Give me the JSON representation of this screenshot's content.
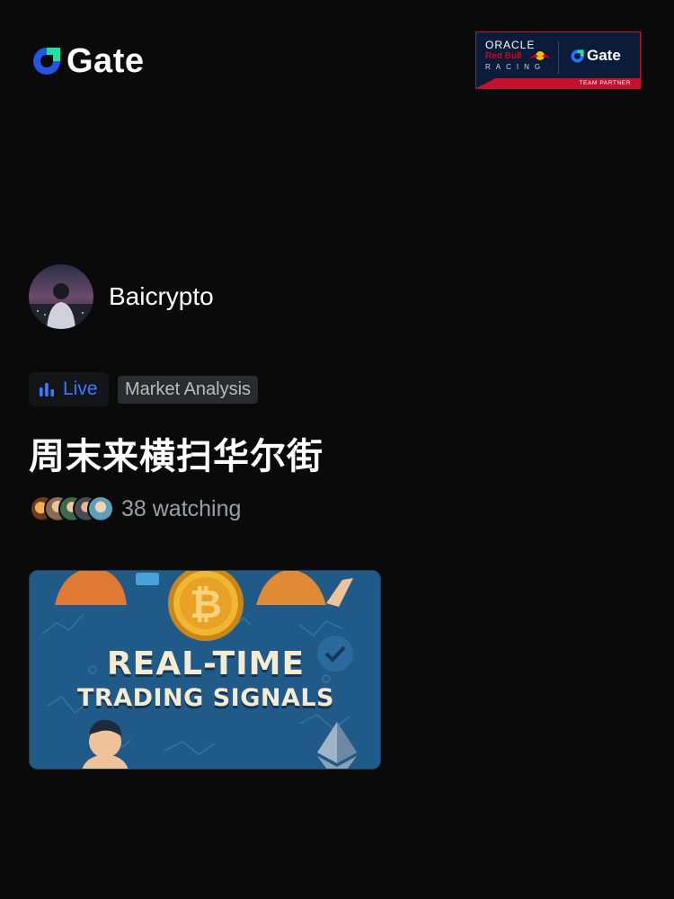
{
  "header": {
    "brand": "Gate",
    "sponsor": {
      "line1": "ORACLE",
      "line2": "Red Bull",
      "line3": "RACING",
      "partner_brand": "Gate",
      "badge": "TEAM PARTNER"
    }
  },
  "profile": {
    "username": "Baicrypto"
  },
  "tags": {
    "live_label": "Live",
    "category": "Market Analysis"
  },
  "stream": {
    "title": "周末来横扫华尔街",
    "watching_text": "38 watching",
    "thumbnail_headline": "REAL-TIME",
    "thumbnail_subline": "TRADING SIGNALS"
  },
  "colors": {
    "background": "#0a0a0b",
    "accent_blue": "#3a7bff",
    "brand_green": "#17e5a1",
    "sponsor_red": "#c8102e"
  },
  "icons": {
    "brand": "gate-logo-icon",
    "live": "bar-chart-icon",
    "thumbnail_coin": "bitcoin-icon"
  }
}
